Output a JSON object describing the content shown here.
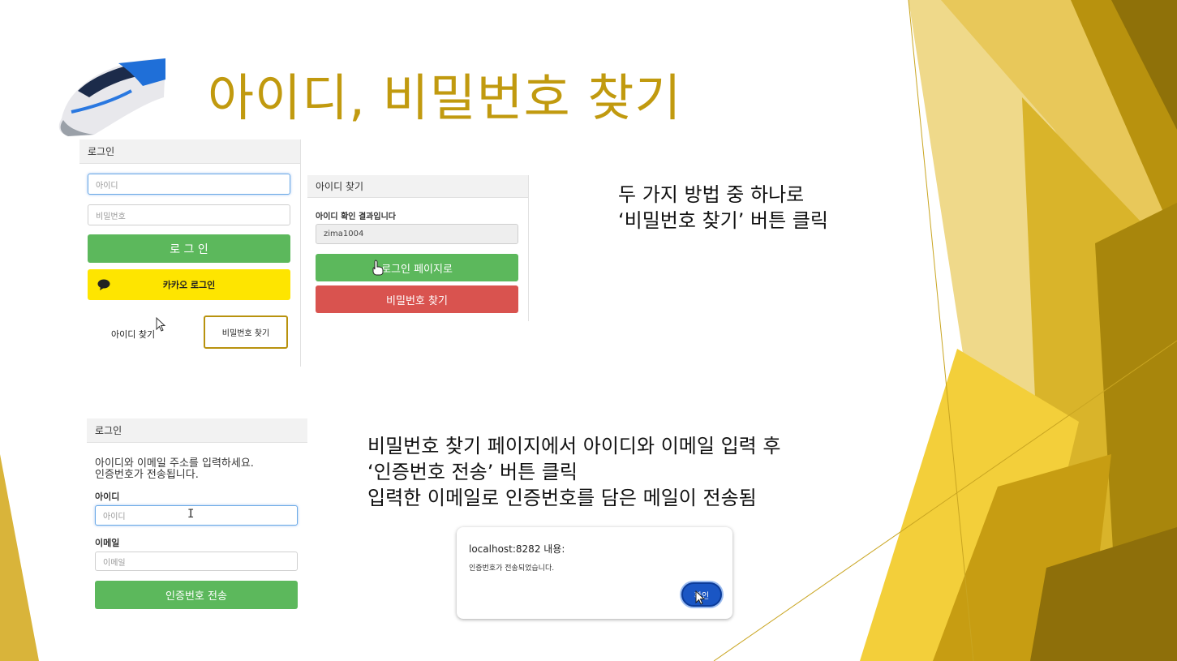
{
  "slide": {
    "title": "아이디, 비밀번호 찾기",
    "accent_color": "#c19a0f",
    "icon": "ktx-train-image"
  },
  "login_panel": {
    "header": "로그인",
    "id_placeholder": "아이디",
    "pw_placeholder": "비밀번호",
    "login_button": "로 그 인",
    "kakao_button": "카카오 로그인",
    "find_id_link": "아이디 찾기",
    "find_pw_button": "비밀번호 찾기"
  },
  "find_id_panel": {
    "header": "아이디 찾기",
    "result_label": "아이디 확인 결과입니다",
    "result_value": "zima1004",
    "login_page_button": "로그인 페이지로",
    "find_pw_button": "비밀번호 찾기"
  },
  "note1": {
    "line1": "두 가지 방법 중 하나로",
    "line2": "‘비밀번호 찾기’ 버튼 클릭"
  },
  "pw_panel": {
    "header": "로그인",
    "instruction_line1": "아이디와 이메일 주소를 입력하세요.",
    "instruction_line2": "인증번호가 전송됩니다.",
    "id_label": "아이디",
    "id_placeholder": "아이디",
    "email_label": "이메일",
    "email_placeholder": "이메일",
    "send_button": "인증번호 전송"
  },
  "note2": {
    "line1": "비밀번호 찾기 페이지에서 아이디와 이메일 입력 후",
    "line2": "‘인증번호 전송’ 버튼 클릭",
    "line3": "입력한 이메일로 인증번호를 담은 메일이 전송됨"
  },
  "alert": {
    "title": "localhost:8282 내용:",
    "message": "인증번호가 전송되었습니다.",
    "ok_button": "확인"
  },
  "colors": {
    "green": "#5cb85c",
    "red": "#d9534f",
    "kakao_yellow": "#fee500",
    "gold": "#c19a0f"
  }
}
